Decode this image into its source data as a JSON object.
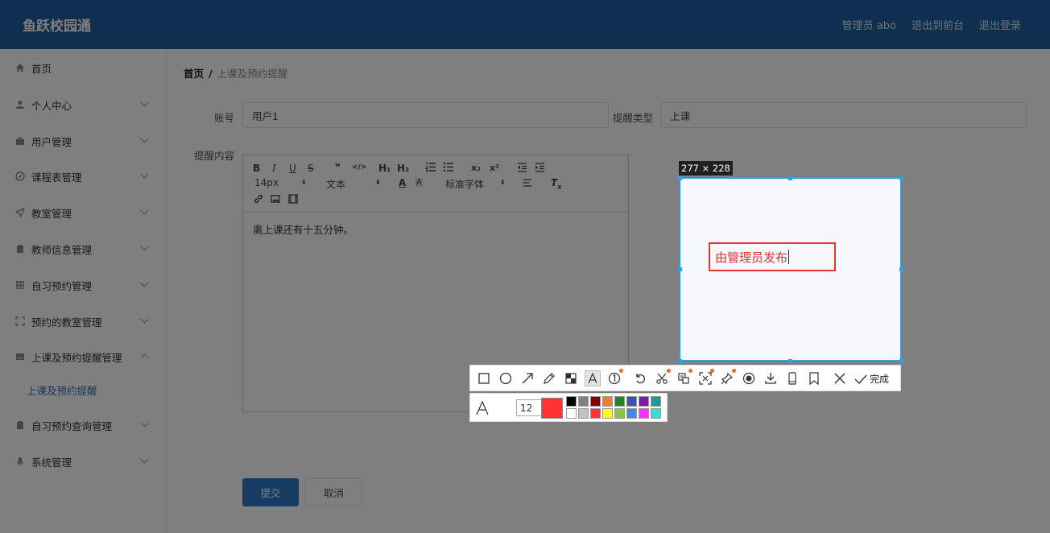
{
  "header": {
    "brand": "鱼跃校园通",
    "admin_label": "管理员 abo",
    "back_to_front": "退出到前台",
    "logout": "退出登录"
  },
  "sidebar": {
    "items": [
      {
        "label": "首页",
        "icon": "home-icon"
      },
      {
        "label": "个人中心",
        "icon": "user-icon"
      },
      {
        "label": "用户管理",
        "icon": "briefcase-icon"
      },
      {
        "label": "课程表管理",
        "icon": "compass-icon"
      },
      {
        "label": "教室管理",
        "icon": "send-icon"
      },
      {
        "label": "教师信息管理",
        "icon": "clipboard-icon"
      },
      {
        "label": "自习预约管理",
        "icon": "grid-icon"
      },
      {
        "label": "预约的教室管理",
        "icon": "fullscreen-icon"
      },
      {
        "label": "上课及预约提醒管理",
        "icon": "picture-icon"
      },
      {
        "label": "自习预约查询管理",
        "icon": "clipboard-icon"
      },
      {
        "label": "系统管理",
        "icon": "microphone-icon"
      }
    ],
    "sub_item": "上课及预约提醒"
  },
  "breadcrumb": {
    "home": "首页",
    "separator": "/",
    "current": "上课及预约提醒"
  },
  "form": {
    "account_label": "账号",
    "account_value": "用户1",
    "type_label": "提醒类型",
    "type_value": "上课",
    "content_label": "提醒内容"
  },
  "editor": {
    "toolbar": {
      "bold": "B",
      "italic": "I",
      "underline": "U",
      "strike": "S",
      "quote": "❞",
      "code": "</>",
      "h1": "H₁",
      "h2": "H₂",
      "sub": "x₂",
      "sup": "x²",
      "font_size": "14px",
      "format": "文本",
      "font_family": "标准字体"
    },
    "content": "离上课还有十五分钟。"
  },
  "buttons": {
    "submit": "提交",
    "cancel": "取消"
  },
  "capture": {
    "size_label": "277 × 228",
    "text_annotation": "由管理员发布",
    "done_label": "完成",
    "font_size": "12",
    "current_color": "#ff3333",
    "palette_top": [
      "#000000",
      "#808080",
      "#800000",
      "#f07f2a",
      "#2e7d32",
      "#3f51b5",
      "#7b1fa2",
      "#169c9c"
    ],
    "palette_bottom": [
      "#ffffff",
      "#c0c0c0",
      "#ff3333",
      "#ffff00",
      "#8bc34a",
      "#3d8be8",
      "#ff33ff",
      "#33dddd"
    ]
  }
}
